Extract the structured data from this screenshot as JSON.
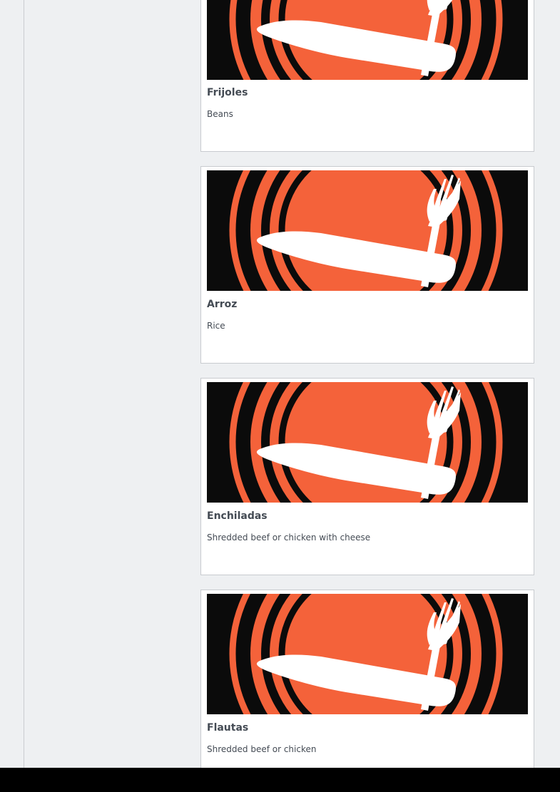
{
  "menu": {
    "items": [
      {
        "name": "Frijoles",
        "description": "Beans",
        "image_icon": "plate-fork-knife-icon"
      },
      {
        "name": "Arroz",
        "description": "Rice",
        "image_icon": "plate-fork-knife-icon"
      },
      {
        "name": "Enchiladas",
        "description": "Shredded beef or chicken with cheese",
        "image_icon": "plate-fork-knife-icon"
      },
      {
        "name": "Flautas",
        "description": "Shredded beef or chicken",
        "image_icon": "plate-fork-knife-icon"
      }
    ]
  },
  "colors": {
    "accent": "#f4623a",
    "image_background": "#0b0b0b",
    "card_border": "#c8cbcf",
    "page_background": "#eef0f2"
  }
}
